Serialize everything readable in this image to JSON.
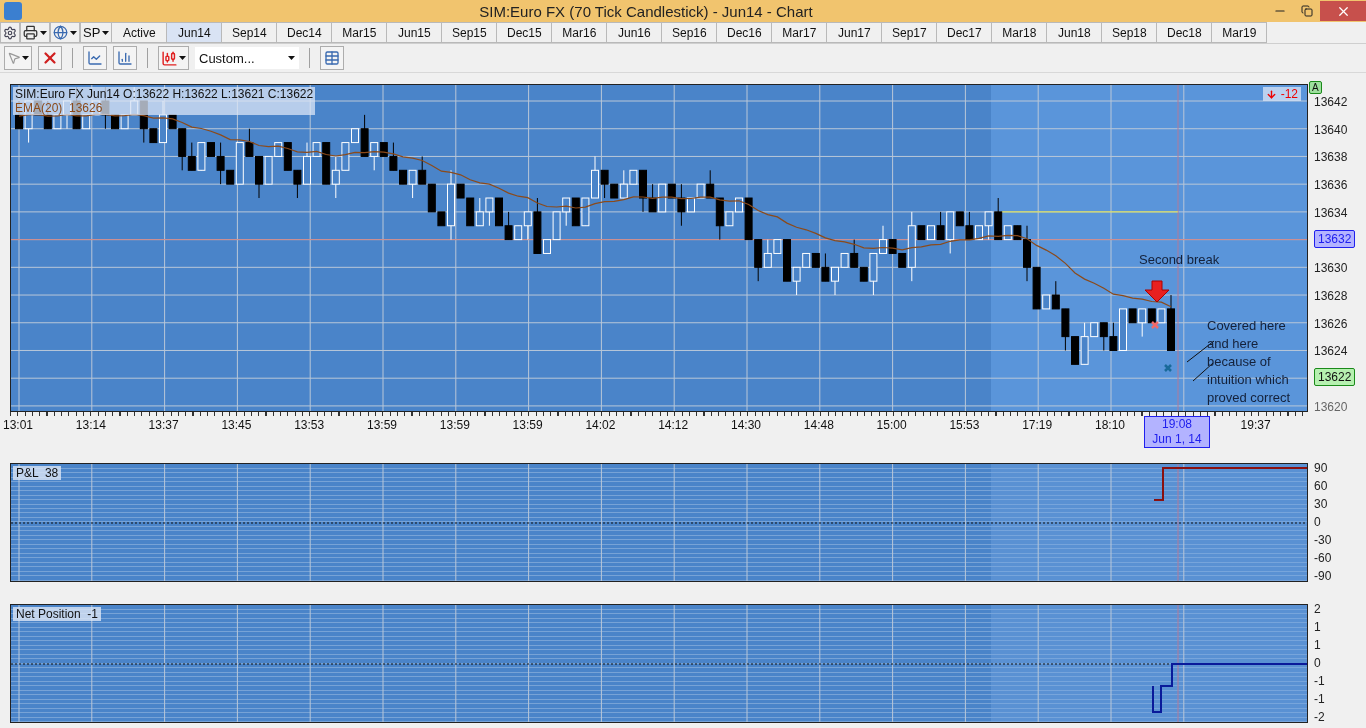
{
  "window": {
    "title": "SIM:Euro FX (70 Tick Candlestick) - Jun14 - Chart"
  },
  "instrument_button": "SP",
  "tabs": [
    {
      "label": "Active",
      "selected": false
    },
    {
      "label": "Jun14",
      "selected": true
    },
    {
      "label": "Sep14",
      "selected": false
    },
    {
      "label": "Dec14",
      "selected": false
    },
    {
      "label": "Mar15",
      "selected": false
    },
    {
      "label": "Jun15",
      "selected": false
    },
    {
      "label": "Sep15",
      "selected": false
    },
    {
      "label": "Dec15",
      "selected": false
    },
    {
      "label": "Mar16",
      "selected": false
    },
    {
      "label": "Jun16",
      "selected": false
    },
    {
      "label": "Sep16",
      "selected": false
    },
    {
      "label": "Dec16",
      "selected": false
    },
    {
      "label": "Mar17",
      "selected": false
    },
    {
      "label": "Jun17",
      "selected": false
    },
    {
      "label": "Sep17",
      "selected": false
    },
    {
      "label": "Dec17",
      "selected": false
    },
    {
      "label": "Mar18",
      "selected": false
    },
    {
      "label": "Jun18",
      "selected": false
    },
    {
      "label": "Sep18",
      "selected": false
    },
    {
      "label": "Dec18",
      "selected": false
    },
    {
      "label": "Mar19",
      "selected": false
    }
  ],
  "toolbar": {
    "chart_style": "Custom..."
  },
  "price_panel": {
    "legend": "SIM:Euro FX Jun14 O:13622 H:13622 L:13621 C:13622",
    "indicator": "EMA(20)  13626",
    "pnl_badge": "-12",
    "scale_badge": "A",
    "price_ticks": [
      "13642",
      "13640",
      "13638",
      "13636",
      "13634",
      "13630",
      "13628",
      "13626",
      "13624",
      "13620"
    ],
    "cursor_price": "13632",
    "last_price": "13622",
    "annotations": [
      "Second break",
      "Covered here and here because of intuition which proved correct"
    ]
  },
  "time_axis": {
    "labels": [
      "13:01",
      "13:14",
      "13:37",
      "13:45",
      "13:53",
      "13:59",
      "13:59",
      "13:59",
      "14:02",
      "14:12",
      "14:30",
      "14:48",
      "15:00",
      "15:53",
      "17:19",
      "18:10",
      "19:37"
    ],
    "cursor_time": "19:08",
    "cursor_date": "Jun 1, 14"
  },
  "pnl_panel": {
    "title": "P&L  38",
    "ticks": [
      "90",
      "60",
      "30",
      "0",
      "-30",
      "-60",
      "-90"
    ]
  },
  "position_panel": {
    "title": "Net Position  -1",
    "ticks": [
      "2",
      "1",
      "1",
      "0",
      "-1",
      "-1",
      "-2"
    ]
  }
}
